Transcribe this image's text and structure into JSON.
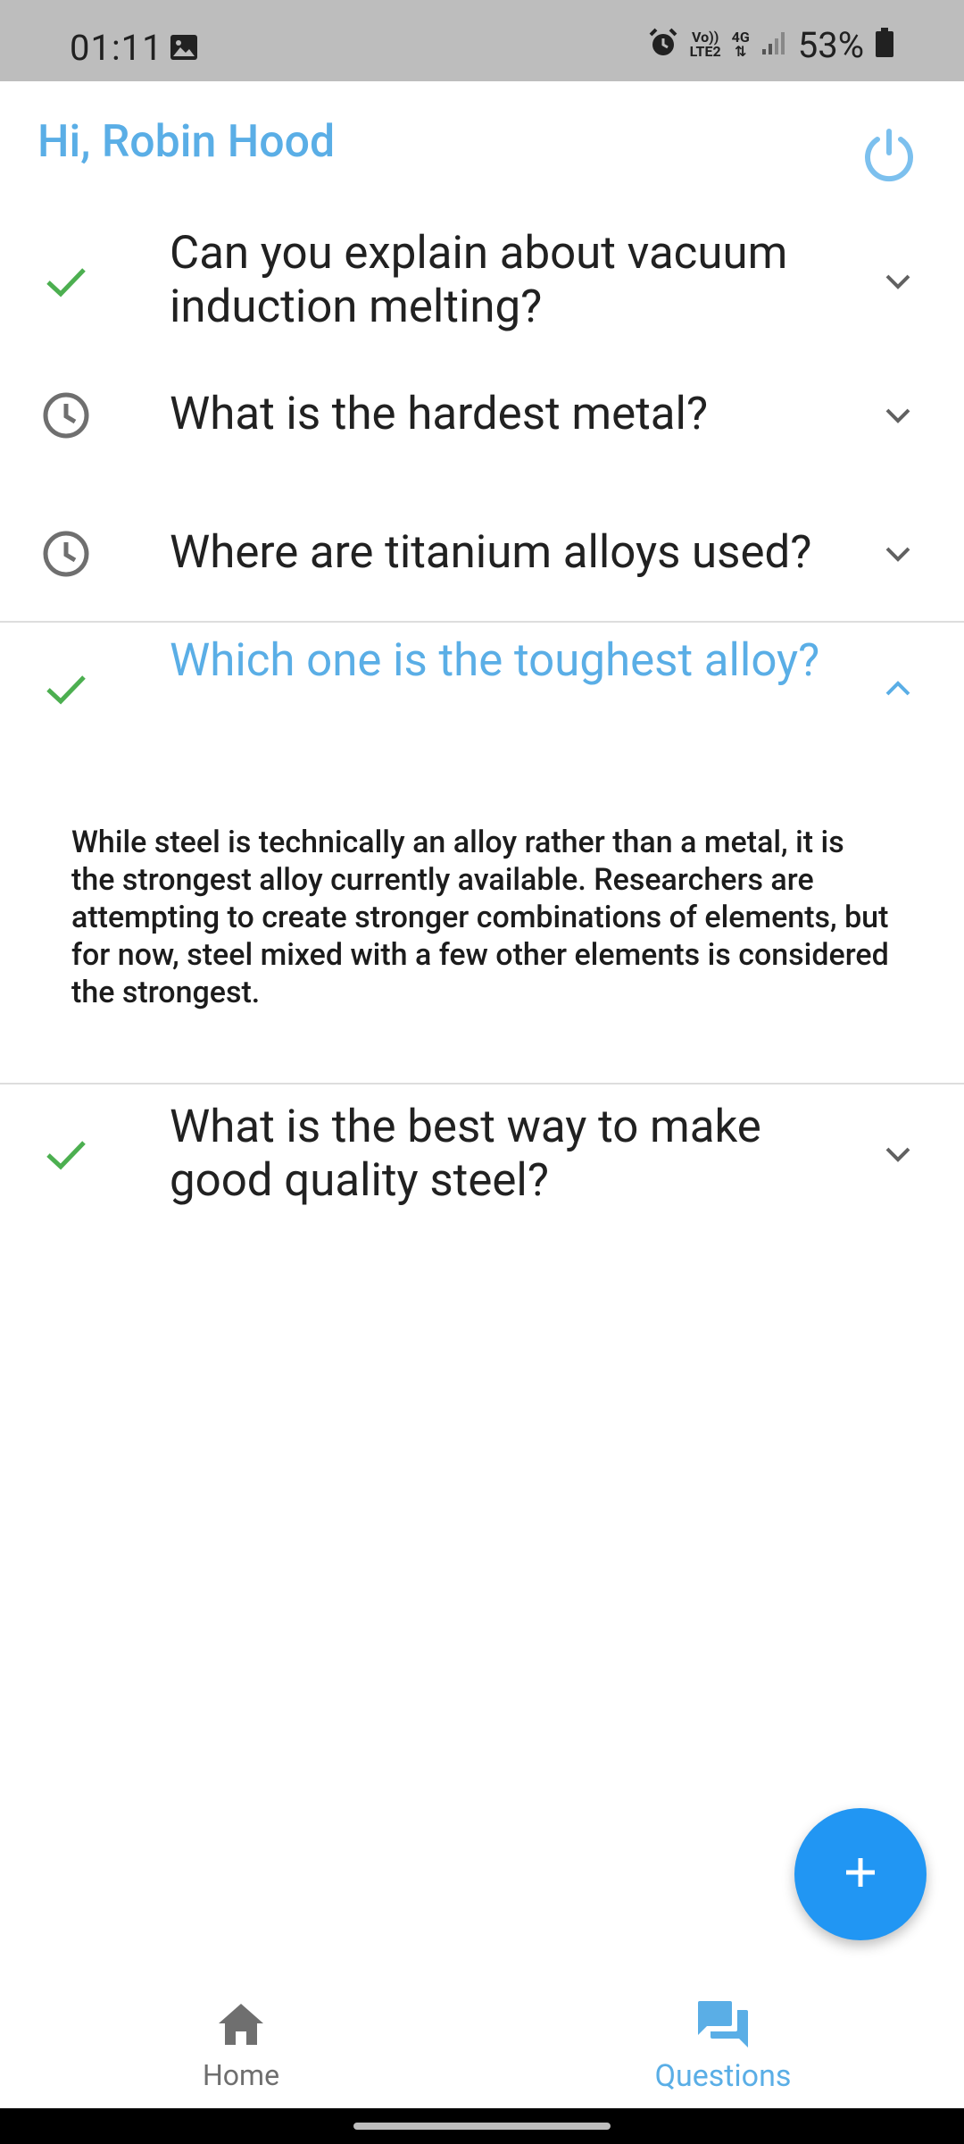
{
  "status_bar": {
    "time": "01:11",
    "volte_label": "Vo))",
    "lte_label": "LTE2",
    "network_label": "4G",
    "battery_percent": "53%",
    "icons": [
      "gallery-icon",
      "alarm-icon",
      "signal-icon",
      "battery-icon"
    ]
  },
  "header": {
    "greeting": "Hi, Robin Hood",
    "power_icon": "power-icon"
  },
  "questions": [
    {
      "text": "Can you explain about vacuum induction melting?",
      "status": "answered",
      "status_icon": "check-icon",
      "expanded": false
    },
    {
      "text": "What is the hardest metal?",
      "status": "pending",
      "status_icon": "clock-icon",
      "expanded": false
    },
    {
      "text": "Where are titanium alloys used?",
      "status": "pending",
      "status_icon": "clock-icon",
      "expanded": false
    },
    {
      "text": "Which one is the  toughest alloy?",
      "status": "answered",
      "status_icon": "check-icon",
      "expanded": true,
      "answer": "While steel is technically an alloy rather than a metal, it is the strongest alloy currently available. Researchers are attempting to create stronger combinations of elements, but for now, steel mixed with a few other elements is considered the strongest."
    },
    {
      "text": "What is the best way to make good quality steel?",
      "status": "answered",
      "status_icon": "check-icon",
      "expanded": false
    }
  ],
  "fab": {
    "icon": "plus-icon"
  },
  "bottom_nav": {
    "items": [
      {
        "label": "Home",
        "icon": "home-icon",
        "active": false
      },
      {
        "label": "Questions",
        "icon": "forum-icon",
        "active": true
      }
    ]
  },
  "colors": {
    "accent": "#5aaee6",
    "fab": "#2196f3",
    "check": "#4caf50",
    "pending": "#6f6f6f",
    "status_bar": "#bdbdbd"
  }
}
